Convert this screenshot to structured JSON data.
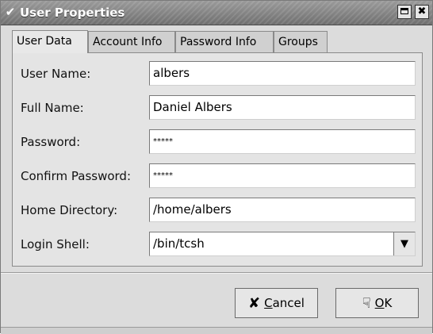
{
  "window": {
    "title": "User Properties",
    "menu_icon": "chevron-down-icon",
    "maximize_icon": "maximize-icon",
    "close_icon": "close-icon",
    "close_glyph": "✖"
  },
  "tabs": [
    {
      "label": "User Data",
      "active": true
    },
    {
      "label": "Account Info",
      "active": false
    },
    {
      "label": "Password Info",
      "active": false
    },
    {
      "label": "Groups",
      "active": false
    }
  ],
  "form": {
    "user_name_label": "User Name:",
    "user_name_value": "albers",
    "full_name_label": "Full Name:",
    "full_name_value": "Daniel Albers",
    "password_label": "Password:",
    "password_value": "*****",
    "confirm_password_label": "Confirm Password:",
    "confirm_password_value": "*****",
    "home_directory_label": "Home Directory:",
    "home_directory_value": "/home/albers",
    "login_shell_label": "Login Shell:",
    "login_shell_value": "/bin/tcsh"
  },
  "buttons": {
    "cancel_mnemonic": "C",
    "cancel_rest": "ancel",
    "cancel_icon": "cross-icon",
    "ok_mnemonic": "O",
    "ok_rest": "K",
    "ok_icon": "hand-icon"
  }
}
